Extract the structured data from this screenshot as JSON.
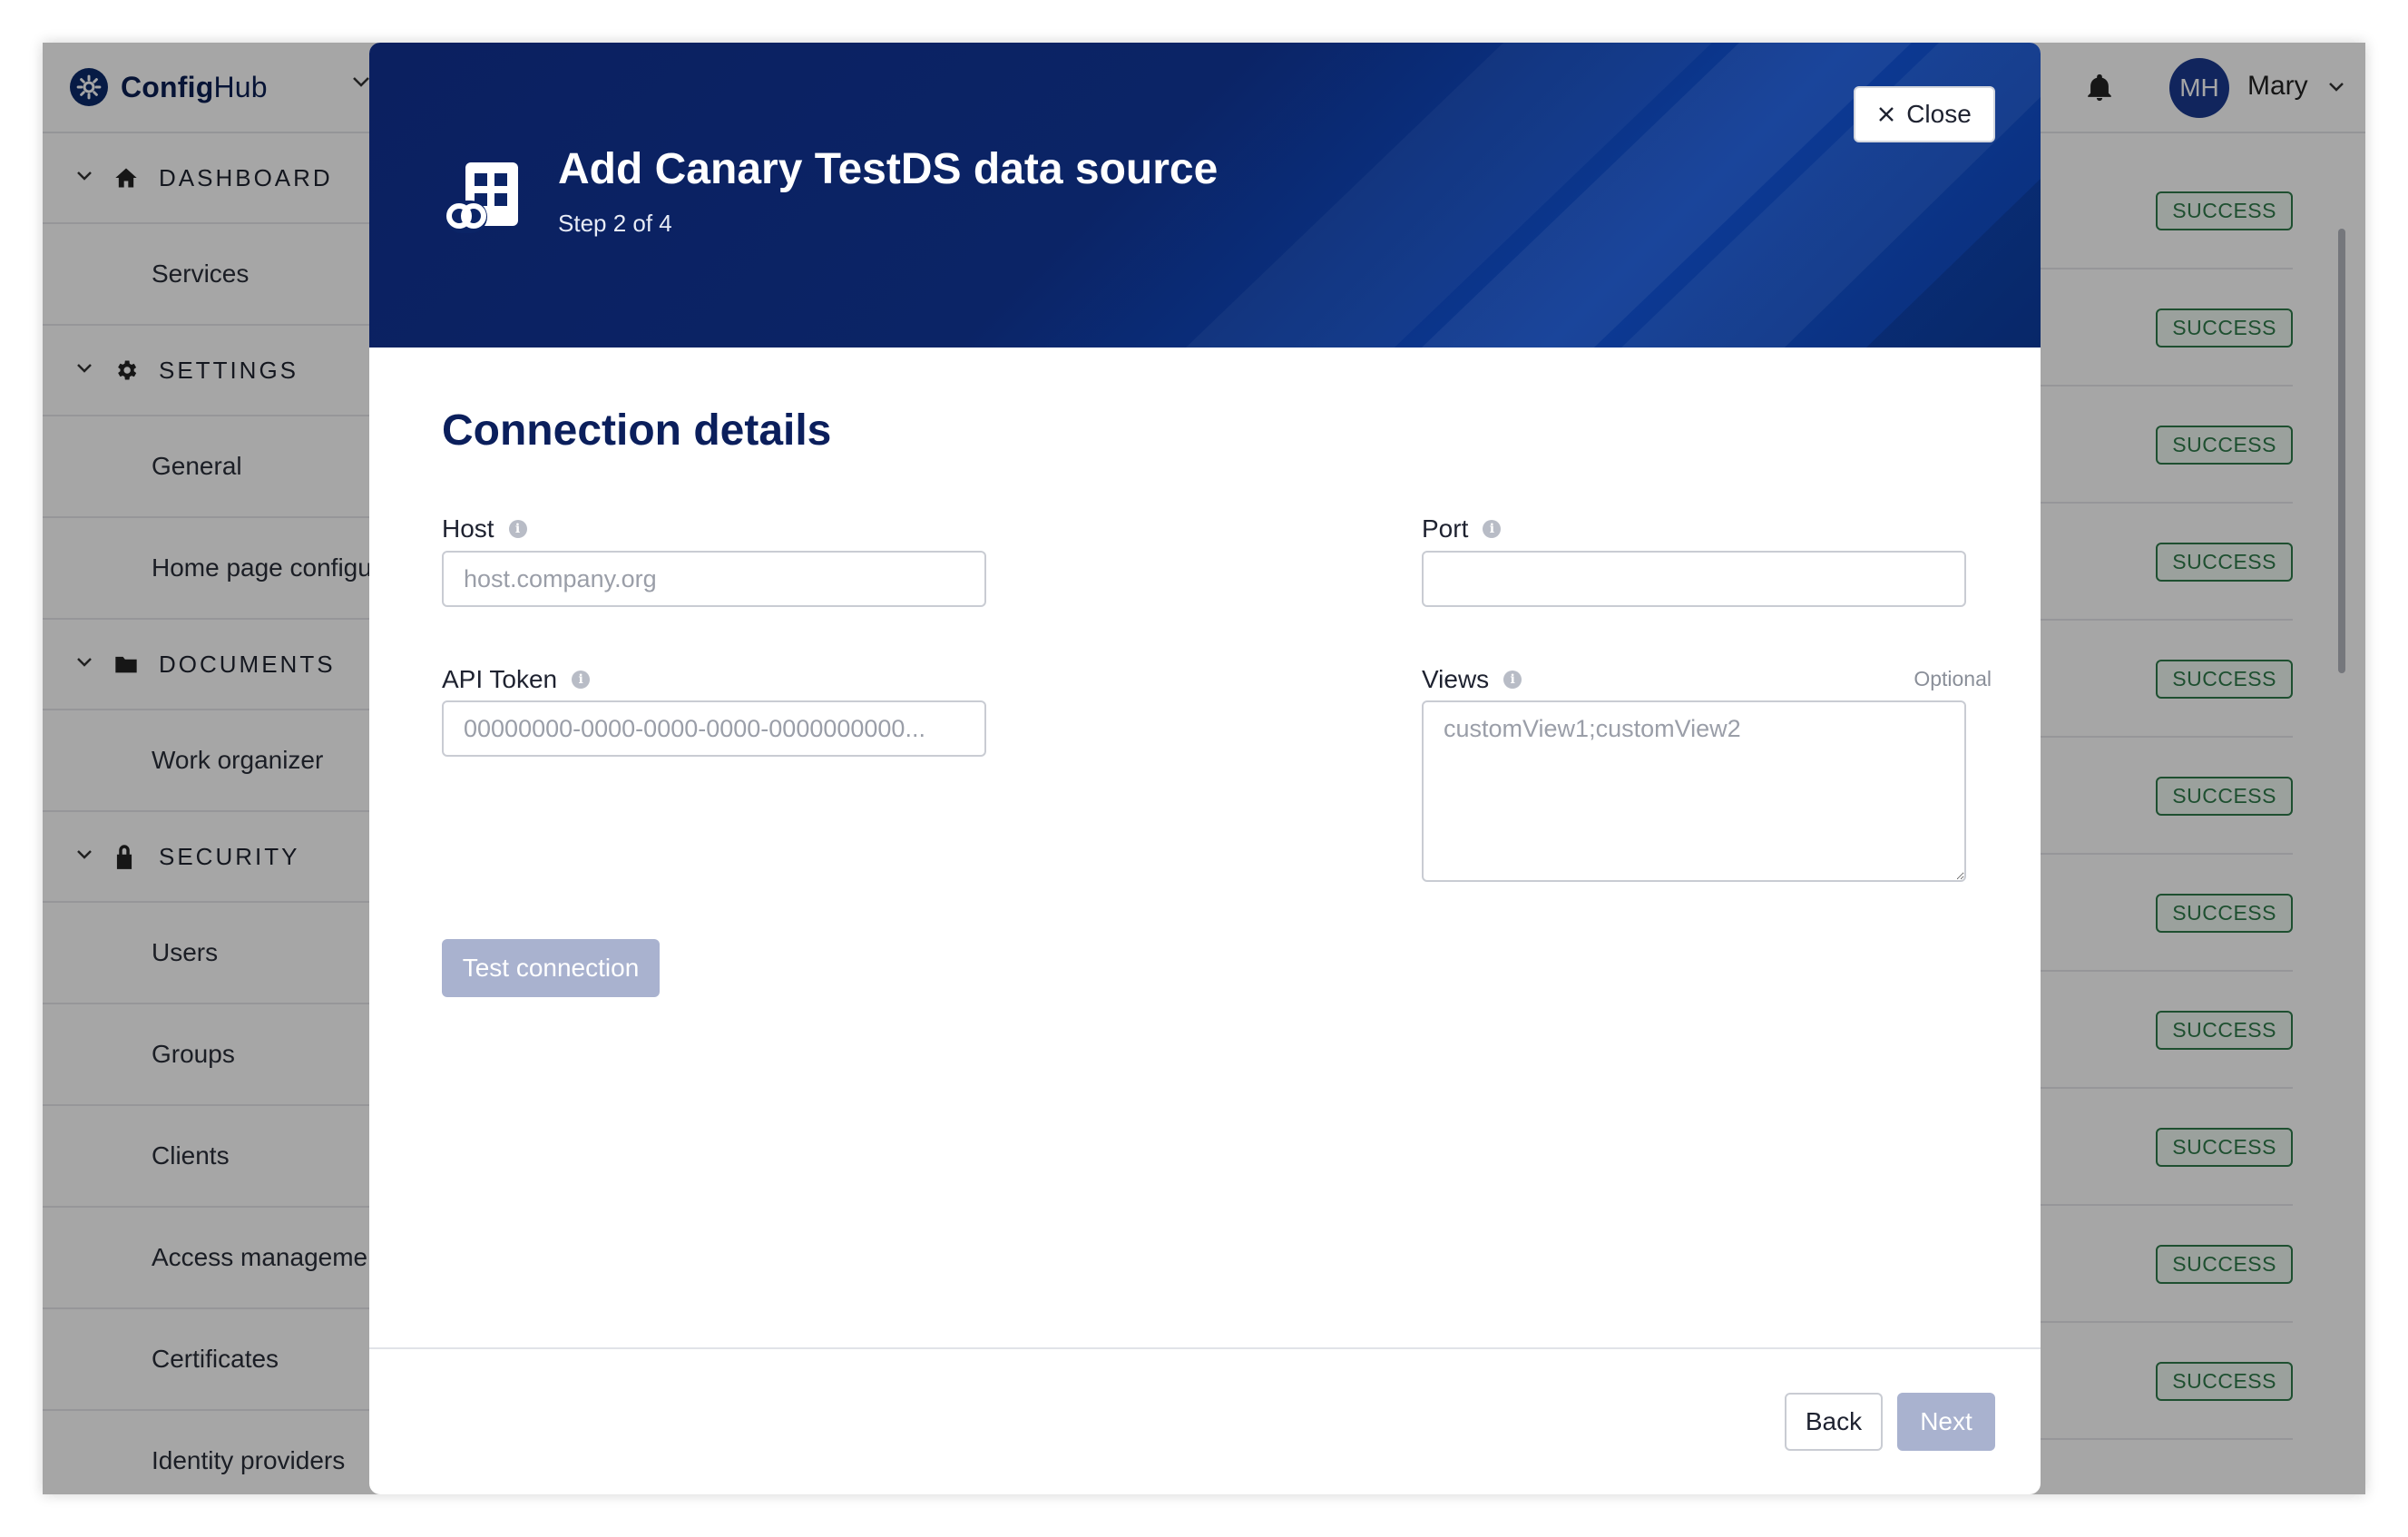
{
  "app": {
    "brand_part1": "Config",
    "brand_part2": "Hub",
    "user": {
      "initials": "MH",
      "name": "Mary"
    }
  },
  "sidebar": {
    "sections": [
      {
        "label": "DASHBOARD",
        "icon": "home-icon",
        "items": [
          "Services"
        ]
      },
      {
        "label": "SETTINGS",
        "icon": "gear-icon",
        "items": [
          "General",
          "Home page configur"
        ]
      },
      {
        "label": "DOCUMENTS",
        "icon": "folder-icon",
        "items": [
          "Work organizer"
        ]
      },
      {
        "label": "SECURITY",
        "icon": "lock-icon",
        "items": [
          "Users",
          "Groups",
          "Clients",
          "Access managemen",
          "Certificates",
          "Identity providers"
        ]
      }
    ]
  },
  "list": {
    "status_badges": [
      "SUCCESS",
      "SUCCESS",
      "SUCCESS",
      "SUCCESS",
      "SUCCESS",
      "SUCCESS",
      "SUCCESS",
      "SUCCESS",
      "SUCCESS",
      "SUCCESS",
      "SUCCESS"
    ]
  },
  "modal": {
    "title": "Add Canary TestDS data source",
    "step": "Step 2 of 4",
    "close_label": "Close",
    "section_title": "Connection details",
    "fields": {
      "host": {
        "label": "Host",
        "placeholder": "host.company.org",
        "value": ""
      },
      "port": {
        "label": "Port",
        "placeholder": "",
        "value": ""
      },
      "api_token": {
        "label": "API Token",
        "placeholder": "00000000-0000-0000-0000-0000000000...",
        "value": ""
      },
      "views": {
        "label": "Views",
        "optional_label": "Optional",
        "placeholder": "customView1;customView2",
        "value": ""
      }
    },
    "test_connection_label": "Test connection",
    "back_label": "Back",
    "next_label": "Next"
  },
  "colors": {
    "brand_navy": "#0b1f5c",
    "header_bg": "#0b2466",
    "disabled_button": "#a9b2cf",
    "success": "#2f7a4a"
  }
}
